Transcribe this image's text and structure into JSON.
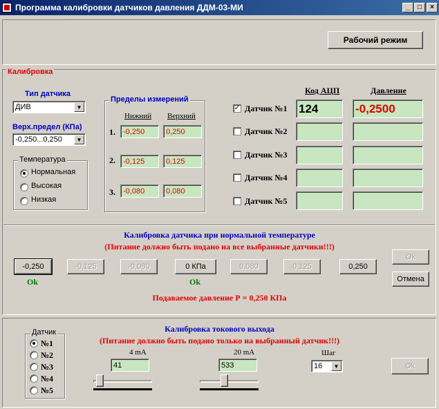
{
  "window": {
    "title": "Программа калибровки датчиков давления ДДМ-03-МИ",
    "minimize": "_",
    "maximize": "□",
    "close": "×"
  },
  "top": {
    "work_mode_button": "Рабочий режим"
  },
  "calibration": {
    "group_title": "Калибровка",
    "sensor_type_label": "Тип датчика",
    "sensor_type_value": "ДИВ",
    "upper_limit_label": "Верх.предел (КПа)",
    "upper_limit_value": "-0,250...0,250",
    "temperature": {
      "title": "Температура",
      "options": [
        "Нормальная",
        "Высокая",
        "Низкая"
      ],
      "selected": 0
    },
    "limits": {
      "title": "Пределы измерений",
      "lower_header": "Нижний",
      "upper_header": "Верхний",
      "rows": [
        {
          "num": "1.",
          "lower": "-0,250",
          "upper": "0,250"
        },
        {
          "num": "2.",
          "lower": "-0,125",
          "upper": "0,125"
        },
        {
          "num": "3.",
          "lower": "-0,080",
          "upper": "0,080"
        }
      ]
    },
    "sensors_header_adc": "Код АЦП",
    "sensors_header_pressure": "Давление",
    "sensors": [
      {
        "label": "Датчик №1",
        "checked": true,
        "adc": "124",
        "pressure": "-0,2500"
      },
      {
        "label": "Датчик №2",
        "checked": false,
        "adc": "",
        "pressure": ""
      },
      {
        "label": "Датчик №3",
        "checked": false,
        "adc": "",
        "pressure": ""
      },
      {
        "label": "Датчик №4",
        "checked": false,
        "adc": "",
        "pressure": ""
      },
      {
        "label": "Датчик №5",
        "checked": false,
        "adc": "",
        "pressure": ""
      }
    ]
  },
  "normal_calib": {
    "title": "Калибровка датчика при нормальной температуре",
    "warning": "(Питание должно быть подано на все выбранные датчики!!!)",
    "buttons": [
      "-0,250",
      "-0,125",
      "-0,080",
      "0 КПа",
      "0,080",
      "0,125",
      "0,250"
    ],
    "ok_label_1": "Ok",
    "ok_label_2": "Ok",
    "ok_button": "Ok",
    "cancel_button": "Отмена",
    "pressure_text": "Подаваемое давление Р = 0,250 КПа"
  },
  "current_out": {
    "title": "Калибровка токового выхода",
    "warning": "(Питание должно быть подано только на выбранный датчик!!!)",
    "sensor_group_title": "Датчик",
    "sensor_options": [
      "№1",
      "№2",
      "№3",
      "№4",
      "№5"
    ],
    "selected_sensor": 0,
    "ma4_label": "4 mA",
    "ma4_value": "41",
    "ma4_slider": 0.05,
    "ma20_label": "20 mA",
    "ma20_value": "533",
    "ma20_slider": 0.4,
    "step_label": "Шаг",
    "step_value": "16",
    "ok_button": "Ok"
  }
}
